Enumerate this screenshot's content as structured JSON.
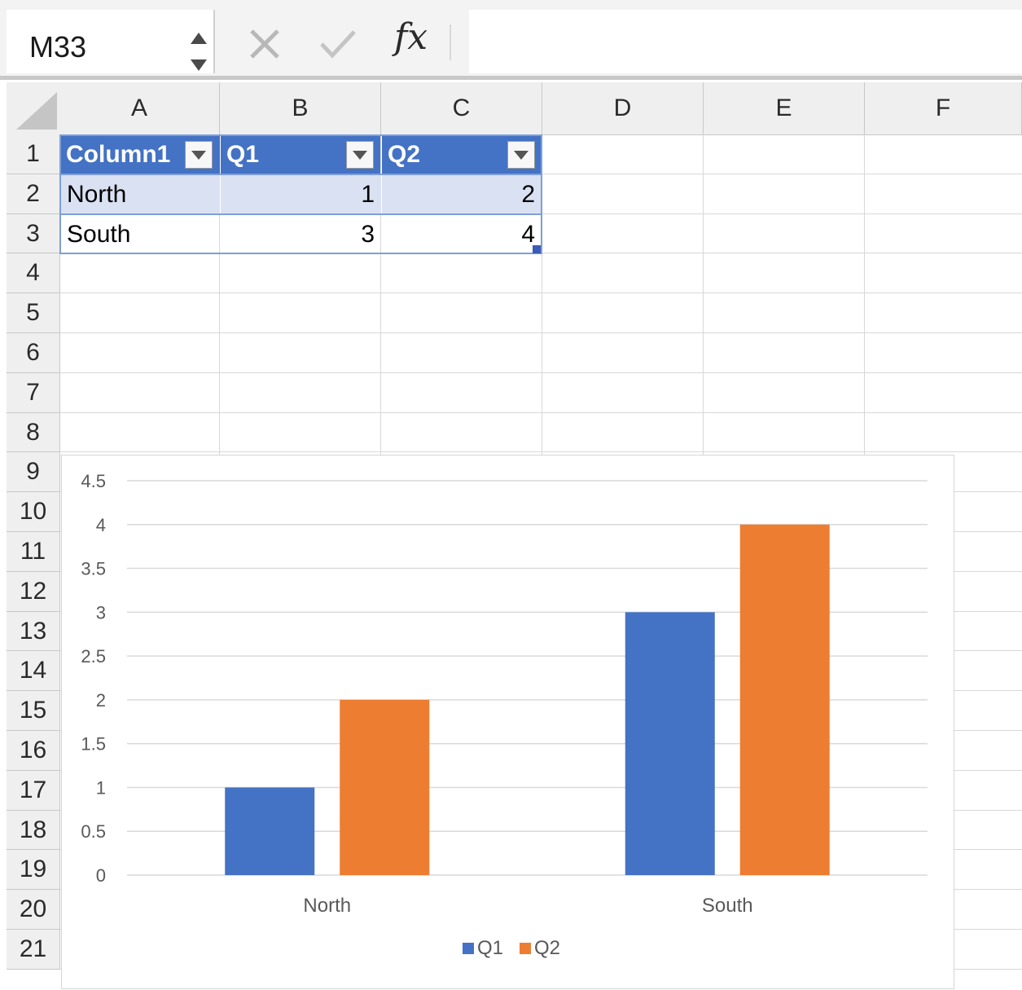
{
  "formula_bar": {
    "name_box": "M33",
    "cancel_icon": "x-icon",
    "confirm_icon": "checkmark-icon",
    "fx_label": "fx",
    "formula": ""
  },
  "columns": [
    "A",
    "B",
    "C",
    "D",
    "E",
    "F"
  ],
  "rows": [
    "1",
    "2",
    "3",
    "4",
    "5",
    "6",
    "7",
    "8",
    "9",
    "10",
    "11",
    "12",
    "13",
    "14",
    "15",
    "16",
    "17",
    "18",
    "19",
    "20",
    "21"
  ],
  "table": {
    "headers": [
      "Column1",
      "Q1",
      "Q2"
    ],
    "rows": [
      [
        "North",
        "1",
        "2"
      ],
      [
        "South",
        "3",
        "4"
      ]
    ]
  },
  "colors": {
    "table_header": "#4472c4",
    "table_band": "#d9e1f2",
    "q1": "#4472c4",
    "q2": "#ed7d31"
  },
  "chart_data": {
    "type": "bar",
    "categories": [
      "North",
      "South"
    ],
    "series": [
      {
        "name": "Q1",
        "values": [
          1,
          3
        ],
        "color": "#4472c4"
      },
      {
        "name": "Q2",
        "values": [
          2,
          4
        ],
        "color": "#ed7d31"
      }
    ],
    "ylim": [
      0,
      4.5
    ],
    "yticks": [
      "0",
      "0.5",
      "1",
      "1.5",
      "2",
      "2.5",
      "3",
      "3.5",
      "4",
      "4.5"
    ],
    "title": "",
    "xlabel": "",
    "ylabel": "",
    "grid": true,
    "legend": "bottom"
  }
}
